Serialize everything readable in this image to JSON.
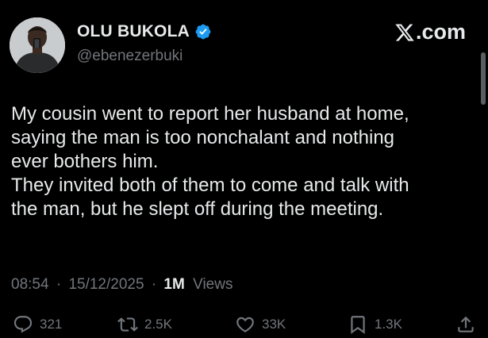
{
  "author": {
    "display_name": "OLU BUKOLA",
    "handle": "@ebenezerbuki",
    "verified": true,
    "verified_color": "#1d9bf0"
  },
  "brand": {
    "label": ".com",
    "icon": "x-logo-icon"
  },
  "tweet": {
    "lines": [
      "My cousin went to report her husband at home,",
      "saying the man is too nonchalant and nothing",
      "ever bothers him.",
      "They invited both of them to come and talk with",
      "the man, but he slept off during the meeting."
    ]
  },
  "meta": {
    "time": "08:54",
    "separator": "·",
    "date": "15/12/2025",
    "views_count": "1M",
    "views_label": "Views"
  },
  "actions": {
    "reply": {
      "icon": "reply-icon",
      "count": "321"
    },
    "retweet": {
      "icon": "retweet-icon",
      "count": "2.5K"
    },
    "like": {
      "icon": "heart-icon",
      "count": "33K"
    },
    "bookmark": {
      "icon": "bookmark-icon",
      "count": "1.3K"
    },
    "share": {
      "icon": "share-icon"
    }
  },
  "colors": {
    "background": "#000000",
    "text": "#e7e9ea",
    "secondary_text": "#71767b"
  }
}
